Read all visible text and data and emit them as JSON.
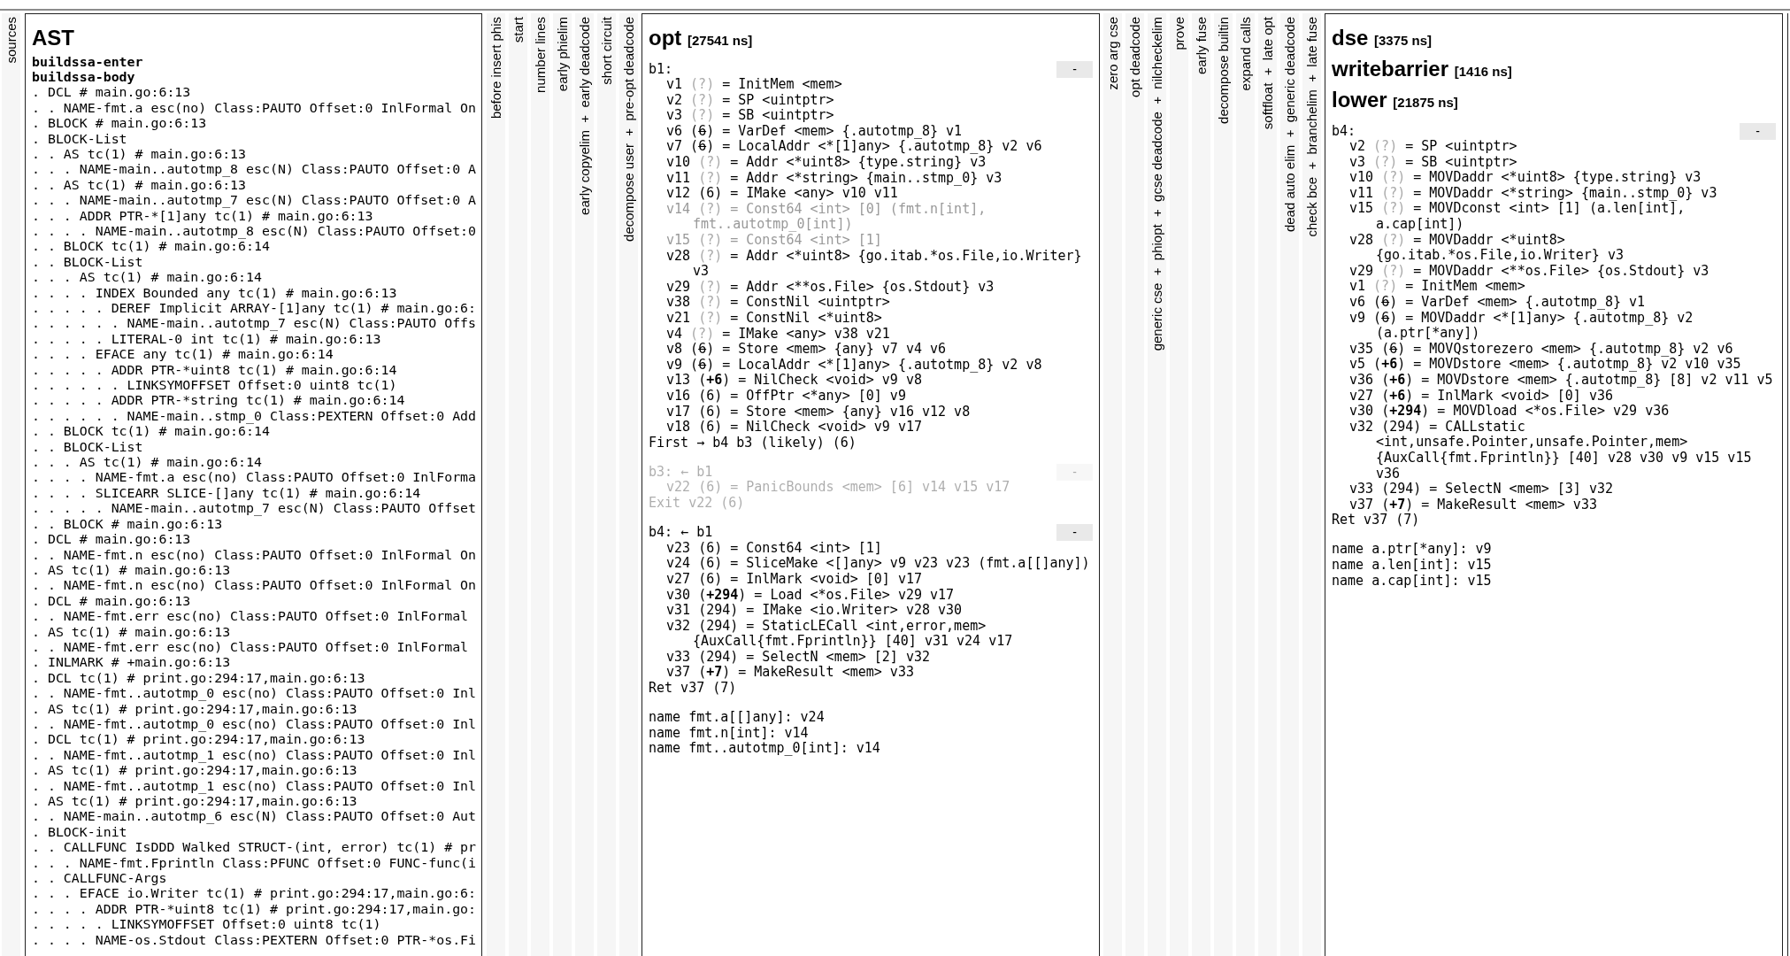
{
  "columns": [
    {
      "kind": "collapsed",
      "label": "sources"
    },
    {
      "kind": "ast",
      "title": "AST",
      "sections": [
        {
          "title": "buildssa-enter"
        },
        {
          "title": "buildssa-body",
          "lines": [
            ". DCL # main.go:6:13",
            ". . NAME-fmt.a esc(no) Class:PAUTO Offset:0 InlFormal On",
            ". BLOCK # main.go:6:13",
            ". BLOCK-List",
            ". . AS tc(1) # main.go:6:13",
            ". . . NAME-main..autotmp_8 esc(N) Class:PAUTO Offset:0 A",
            ". . AS tc(1) # main.go:6:13",
            ". . . NAME-main..autotmp_7 esc(N) Class:PAUTO Offset:0 A",
            ". . . ADDR PTR-*[1]any tc(1) # main.go:6:13",
            ". . . . NAME-main..autotmp_8 esc(N) Class:PAUTO Offset:0",
            ". . BLOCK tc(1) # main.go:6:14",
            ". . BLOCK-List",
            ". . . AS tc(1) # main.go:6:14",
            ". . . . INDEX Bounded any tc(1) # main.go:6:13",
            ". . . . . DEREF Implicit ARRAY-[1]any tc(1) # main.go:6:",
            ". . . . . . NAME-main..autotmp_7 esc(N) Class:PAUTO Offs",
            ". . . . . LITERAL-0 int tc(1) # main.go:6:13",
            ". . . . EFACE any tc(1) # main.go:6:14",
            ". . . . . ADDR PTR-*uint8 tc(1) # main.go:6:14",
            ". . . . . . LINKSYMOFFSET Offset:0 uint8 tc(1)",
            ". . . . . ADDR PTR-*string tc(1) # main.go:6:14",
            ". . . . . . NAME-main..stmp_0 Class:PEXTERN Offset:0 Add",
            ". . BLOCK tc(1) # main.go:6:14",
            ". . BLOCK-List",
            ". . . AS tc(1) # main.go:6:14",
            ". . . . NAME-fmt.a esc(no) Class:PAUTO Offset:0 InlForma",
            ". . . . SLICEARR SLICE-[]any tc(1) # main.go:6:14",
            ". . . . . NAME-main..autotmp_7 esc(N) Class:PAUTO Offset",
            ". . BLOCK # main.go:6:13",
            ". DCL # main.go:6:13",
            ". . NAME-fmt.n esc(no) Class:PAUTO Offset:0 InlFormal On",
            ". AS tc(1) # main.go:6:13",
            ". . NAME-fmt.n esc(no) Class:PAUTO Offset:0 InlFormal On",
            ". DCL # main.go:6:13",
            ". . NAME-fmt.err esc(no) Class:PAUTO Offset:0 InlFormal",
            ". AS tc(1) # main.go:6:13",
            ". . NAME-fmt.err esc(no) Class:PAUTO Offset:0 InlFormal",
            ". INLMARK # +main.go:6:13",
            ". DCL tc(1) # print.go:294:17,main.go:6:13",
            ". . NAME-fmt..autotmp_0 esc(no) Class:PAUTO Offset:0 Inl",
            ". AS tc(1) # print.go:294:17,main.go:6:13",
            ". . NAME-fmt..autotmp_0 esc(no) Class:PAUTO Offset:0 Inl",
            ". DCL tc(1) # print.go:294:17,main.go:6:13",
            ". . NAME-fmt..autotmp_1 esc(no) Class:PAUTO Offset:0 Inl",
            ". AS tc(1) # print.go:294:17,main.go:6:13",
            ". . NAME-fmt..autotmp_1 esc(no) Class:PAUTO Offset:0 Inl",
            ". AS tc(1) # print.go:294:17,main.go:6:13",
            ". . NAME-main..autotmp_6 esc(N) Class:PAUTO Offset:0 Aut",
            ". BLOCK-init",
            ". . CALLFUNC IsDDD Walked STRUCT-(int, error) tc(1) # pr",
            ". . . NAME-fmt.Fprintln Class:PFUNC Offset:0 FUNC-func(i",
            ". . CALLFUNC-Args",
            ". . . EFACE io.Writer tc(1) # print.go:294:17,main.go:6:",
            ". . . . ADDR PTR-*uint8 tc(1) # print.go:294:17,main.go:",
            ". . . . . LINKSYMOFFSET Offset:0 uint8 tc(1)",
            ". . . . NAME-os.Stdout Class:PEXTERN Offset:0 PTR-*os.Fi"
          ]
        }
      ]
    },
    {
      "kind": "collapsed",
      "label": "before insert phis"
    },
    {
      "kind": "collapsed",
      "label": "start"
    },
    {
      "kind": "collapsed",
      "label": "number lines"
    },
    {
      "kind": "collapsed",
      "label": "early phielim"
    },
    {
      "kind": "collapsed",
      "label": "early copyelim  +  early deadcode"
    },
    {
      "kind": "collapsed",
      "label": "short circuit"
    },
    {
      "kind": "collapsed",
      "label": "decompose user  +  pre-opt deadcode"
    },
    {
      "kind": "ssa",
      "headings": [
        {
          "name": "opt",
          "time": "[27541 ns]"
        }
      ],
      "blocks": [
        {
          "header": "b1:",
          "toggle": "-",
          "dead": false,
          "values": [
            {
              "id": "v1",
              "pos": "(?)",
              "kind": "unknown",
              "text": "= InitMem <mem>",
              "dead": false
            },
            {
              "id": "v2",
              "pos": "(?)",
              "kind": "unknown",
              "text": "= SP <uintptr>",
              "dead": false
            },
            {
              "id": "v3",
              "pos": "(?)",
              "kind": "unknown",
              "text": "= SB <uintptr>",
              "dead": false
            },
            {
              "id": "v6",
              "pos": "(6)",
              "kind": "nonstmt",
              "text": "= VarDef <mem> {.autotmp_8} v1",
              "dead": false
            },
            {
              "id": "v7",
              "pos": "(6)",
              "kind": "nonstmt",
              "text": "= LocalAddr <*[1]any> {.autotmp_8} v2 v6",
              "dead": false
            },
            {
              "id": "v10",
              "pos": "(?)",
              "kind": "unknown",
              "text": "= Addr <*uint8> {type.string} v3",
              "dead": false
            },
            {
              "id": "v11",
              "pos": "(?)",
              "kind": "unknown",
              "text": "= Addr <*string> {main..stmp_0} v3",
              "dead": false
            },
            {
              "id": "v12",
              "pos": "(6)",
              "kind": "plain",
              "text": "= IMake <any> v10 v11",
              "dead": false
            },
            {
              "id": "v14",
              "pos": "(?)",
              "kind": "unknown",
              "text": "= Const64 <int> [0] (fmt.n[int], fmt..autotmp_0[int])",
              "dead": true
            },
            {
              "id": "v15",
              "pos": "(?)",
              "kind": "unknown",
              "text": "= Const64 <int> [1]",
              "dead": true
            },
            {
              "id": "v28",
              "pos": "(?)",
              "kind": "unknown",
              "text": "= Addr <*uint8> {go.itab.*os.File,io.Writer} v3",
              "dead": false
            },
            {
              "id": "v29",
              "pos": "(?)",
              "kind": "unknown",
              "text": "= Addr <**os.File> {os.Stdout} v3",
              "dead": false
            },
            {
              "id": "v38",
              "pos": "(?)",
              "kind": "unknown",
              "text": "= ConstNil <uintptr>",
              "dead": false
            },
            {
              "id": "v21",
              "pos": "(?)",
              "kind": "unknown",
              "text": "= ConstNil <*uint8>",
              "dead": false
            },
            {
              "id": "v4",
              "pos": "(?)",
              "kind": "unknown",
              "text": "= IMake <any> v38 v21",
              "dead": false
            },
            {
              "id": "v8",
              "pos": "(6)",
              "kind": "nonstmt",
              "text": "= Store <mem> {any} v7 v4 v6",
              "dead": false
            },
            {
              "id": "v9",
              "pos": "(6)",
              "kind": "nonstmt",
              "text": "= LocalAddr <*[1]any> {.autotmp_8} v2 v8",
              "dead": false
            },
            {
              "id": "v13",
              "pos": "(+6)",
              "kind": "stmt",
              "text": "= NilCheck <void> v9 v8",
              "dead": false
            },
            {
              "id": "v16",
              "pos": "(6)",
              "kind": "plain",
              "text": "= OffPtr <*any> [0] v9",
              "dead": false
            },
            {
              "id": "v17",
              "pos": "(6)",
              "kind": "plain",
              "text": "= Store <mem> {any} v16 v12 v8",
              "dead": false
            },
            {
              "id": "v18",
              "pos": "(6)",
              "kind": "plain",
              "text": "= NilCheck <void> v9 v17",
              "dead": false
            }
          ],
          "control": "First → b4 b3 (likely) (6)"
        },
        {
          "header": "b3: ← b1",
          "toggle": "-",
          "dead": true,
          "values": [
            {
              "id": "v22",
              "pos": "(6)",
              "kind": "plain",
              "text": "= PanicBounds <mem> [6] v14 v15 v17",
              "dead": false
            }
          ],
          "control": "Exit v22 (6)"
        },
        {
          "header": "b4: ← b1",
          "toggle": "-",
          "dead": false,
          "values": [
            {
              "id": "v23",
              "pos": "(6)",
              "kind": "plain",
              "text": "= Const64 <int> [1]",
              "dead": false
            },
            {
              "id": "v24",
              "pos": "(6)",
              "kind": "plain",
              "text": "= SliceMake <[]any> v9 v23 v23 (fmt.a[[]any])",
              "dead": false
            },
            {
              "id": "v27",
              "pos": "(6)",
              "kind": "plain",
              "text": "= InlMark <void> [0] v17",
              "dead": false
            },
            {
              "id": "v30",
              "pos": "(+294)",
              "kind": "stmt",
              "text": "= Load <*os.File> v29 v17",
              "dead": false
            },
            {
              "id": "v31",
              "pos": "(294)",
              "kind": "plain",
              "text": "= IMake <io.Writer> v28 v30",
              "dead": false
            },
            {
              "id": "v32",
              "pos": "(294)",
              "kind": "plain",
              "text": "= StaticLECall <int,error,mem> {AuxCall{fmt.Fprintln}} [40] v31 v24 v17",
              "dead": false
            },
            {
              "id": "v33",
              "pos": "(294)",
              "kind": "plain",
              "text": "= SelectN <mem> [2] v32",
              "dead": false
            },
            {
              "id": "v37",
              "pos": "(+7)",
              "kind": "stmt",
              "text": "= MakeResult <mem> v33",
              "dead": false
            }
          ],
          "control": "Ret v37 (7)"
        }
      ],
      "names": [
        "name fmt.a[[]any]: v24",
        "name fmt.n[int]: v14",
        "name fmt..autotmp_0[int]: v14"
      ]
    },
    {
      "kind": "collapsed",
      "label": "zero arg cse"
    },
    {
      "kind": "collapsed",
      "label": "opt deadcode"
    },
    {
      "kind": "collapsed",
      "label": "generic cse  +  phiopt  +  gcse deadcode  +  nilcheckelim"
    },
    {
      "kind": "collapsed",
      "label": "prove"
    },
    {
      "kind": "collapsed",
      "label": "early fuse"
    },
    {
      "kind": "collapsed",
      "label": "decompose builtin"
    },
    {
      "kind": "collapsed",
      "label": "expand calls"
    },
    {
      "kind": "collapsed",
      "label": "softfloat  +  late opt"
    },
    {
      "kind": "collapsed",
      "label": "dead auto elim  +  generic deadcode"
    },
    {
      "kind": "collapsed",
      "label": "check bce  +  branchelim  +  late fuse"
    },
    {
      "kind": "ssa",
      "headings": [
        {
          "name": "dse",
          "time": "[3375 ns]"
        },
        {
          "name": "writebarrier",
          "time": "[1416 ns]"
        },
        {
          "name": "lower",
          "time": "[21875 ns]"
        }
      ],
      "blocks": [
        {
          "header": "b4:",
          "toggle": "-",
          "dead": false,
          "values": [
            {
              "id": "v2",
              "pos": "(?)",
              "kind": "unknown",
              "text": "= SP <uintptr>",
              "dead": false
            },
            {
              "id": "v3",
              "pos": "(?)",
              "kind": "unknown",
              "text": "= SB <uintptr>",
              "dead": false
            },
            {
              "id": "v10",
              "pos": "(?)",
              "kind": "unknown",
              "text": "= MOVDaddr <*uint8> {type.string} v3",
              "dead": false
            },
            {
              "id": "v11",
              "pos": "(?)",
              "kind": "unknown",
              "text": "= MOVDaddr <*string> {main..stmp_0} v3",
              "dead": false
            },
            {
              "id": "v15",
              "pos": "(?)",
              "kind": "unknown",
              "text": "= MOVDconst <int> [1] (a.len[int], a.cap[int])",
              "dead": false
            },
            {
              "id": "v28",
              "pos": "(?)",
              "kind": "unknown",
              "text": "= MOVDaddr <*uint8> {go.itab.*os.File,io.Writer} v3",
              "dead": false
            },
            {
              "id": "v29",
              "pos": "(?)",
              "kind": "unknown",
              "text": "= MOVDaddr <**os.File> {os.Stdout} v3",
              "dead": false
            },
            {
              "id": "v1",
              "pos": "(?)",
              "kind": "unknown",
              "text": "= InitMem <mem>",
              "dead": false
            },
            {
              "id": "v6",
              "pos": "(6)",
              "kind": "nonstmt",
              "text": "= VarDef <mem> {.autotmp_8} v1",
              "dead": false
            },
            {
              "id": "v9",
              "pos": "(6)",
              "kind": "nonstmt",
              "text": "= MOVDaddr <*[1]any> {.autotmp_8} v2 (a.ptr[*any])",
              "dead": false
            },
            {
              "id": "v35",
              "pos": "(6)",
              "kind": "nonstmt",
              "text": "= MOVQstorezero <mem> {.autotmp_8} v2 v6",
              "dead": false
            },
            {
              "id": "v5",
              "pos": "(+6)",
              "kind": "stmt",
              "text": "= MOVDstore <mem> {.autotmp_8} v2 v10 v35",
              "dead": false
            },
            {
              "id": "v36",
              "pos": "(+6)",
              "kind": "stmt",
              "text": "= MOVDstore <mem> {.autotmp_8} [8] v2 v11 v5",
              "dead": false
            },
            {
              "id": "v27",
              "pos": "(+6)",
              "kind": "stmt",
              "text": "= InlMark <void> [0] v36",
              "dead": false
            },
            {
              "id": "v30",
              "pos": "(+294)",
              "kind": "stmt",
              "text": "= MOVDload <*os.File> v29 v36",
              "dead": false
            },
            {
              "id": "v32",
              "pos": "(294)",
              "kind": "plain",
              "text": "= CALLstatic <int,unsafe.Pointer,unsafe.Pointer,mem> {AuxCall{fmt.Fprintln}} [40] v28 v30 v9 v15 v15 v36",
              "dead": false
            },
            {
              "id": "v33",
              "pos": "(294)",
              "kind": "plain",
              "text": "= SelectN <mem> [3] v32",
              "dead": false
            },
            {
              "id": "v37",
              "pos": "(+7)",
              "kind": "stmt",
              "text": "= MakeResult <mem> v33",
              "dead": false
            }
          ],
          "control": "Ret v37 (7)"
        }
      ],
      "names": [
        "name a.ptr[*any]: v9",
        "name a.len[int]: v15",
        "name a.cap[int]: v15"
      ]
    }
  ]
}
